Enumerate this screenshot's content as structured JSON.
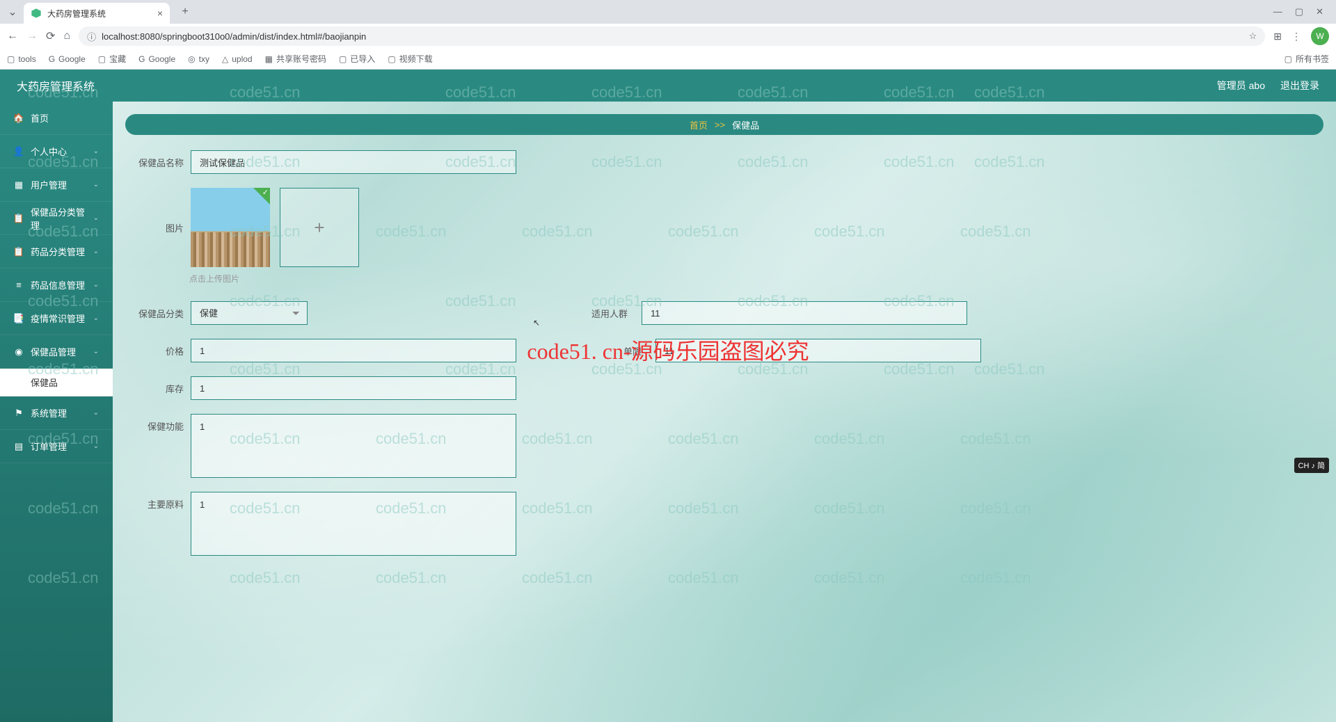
{
  "browser": {
    "tab_title": "大药房管理系统",
    "url": "localhost:8080/springboot310o0/admin/dist/index.html#/baojianpin",
    "bookmarks": [
      "tools",
      "Google",
      "宝藏",
      "Google",
      "txy",
      "uplod",
      "共享账号密码",
      "已导入",
      "视频下载"
    ],
    "all_bookmarks": "所有书签",
    "avatar_letter": "W"
  },
  "topbar": {
    "title": "大药房管理系统",
    "user": "管理员 abo",
    "logout": "退出登录"
  },
  "sidebar": {
    "items": [
      {
        "icon": "🏠",
        "label": "首页",
        "expandable": false
      },
      {
        "icon": "👤",
        "label": "个人中心",
        "expandable": true
      },
      {
        "icon": "▦",
        "label": "用户管理",
        "expandable": true
      },
      {
        "icon": "📋",
        "label": "保健品分类管理",
        "expandable": true
      },
      {
        "icon": "📋",
        "label": "药品分类管理",
        "expandable": true
      },
      {
        "icon": "≡",
        "label": "药品信息管理",
        "expandable": true
      },
      {
        "icon": "📑",
        "label": "疫情常识管理",
        "expandable": true
      },
      {
        "icon": "◉",
        "label": "保健品管理",
        "expandable": true
      },
      {
        "icon": "",
        "label": "保健品",
        "sub": true
      },
      {
        "icon": "⚑",
        "label": "系统管理",
        "expandable": true
      },
      {
        "icon": "▤",
        "label": "订单管理",
        "expandable": true
      }
    ]
  },
  "breadcrumb": {
    "home": "首页",
    "sep": ">>",
    "current": "保健品"
  },
  "form": {
    "name_label": "保健品名称",
    "name_value": "测试保健品",
    "image_label": "图片",
    "upload_hint": "点击上传图片",
    "category_label": "保健品分类",
    "category_value": "保健",
    "crowd_label": "适用人群",
    "crowd_value": "11",
    "price_label": "价格",
    "price_value": "1",
    "limit_label": "单限",
    "limit_value": "11",
    "stock_label": "库存",
    "stock_value": "1",
    "function_label": "保健功能",
    "function_value": "1",
    "material_label": "主要原料",
    "material_value": "1"
  },
  "watermark": {
    "text": "code51.cn",
    "center": "code51. cn-源码乐园盗图必究"
  },
  "ime": "CH ♪ 简"
}
